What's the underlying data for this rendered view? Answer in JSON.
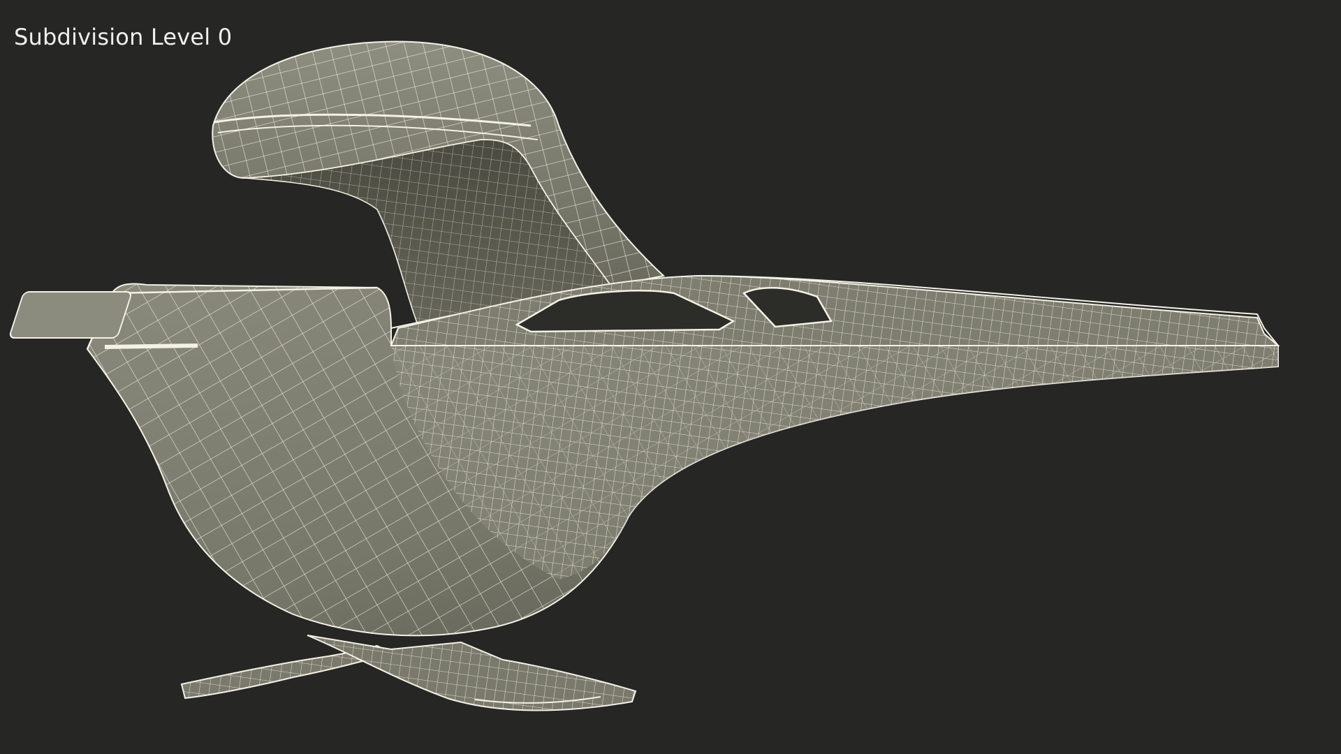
{
  "viewport": {
    "label": "Subdivision Level 0",
    "background": "#262625",
    "mesh_fill": "#7a7a6c",
    "mesh_fill_dark": "#55554a",
    "wire_color": "#f4f2e6"
  }
}
